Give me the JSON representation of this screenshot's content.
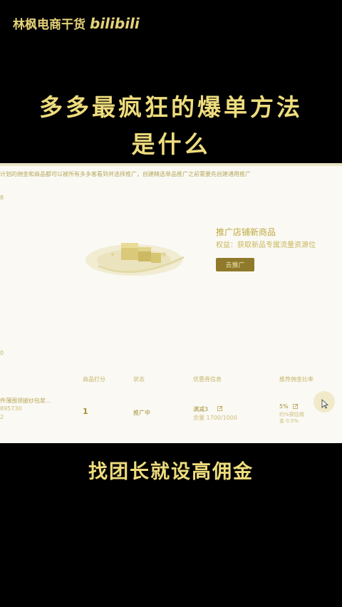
{
  "watermark": {
    "channel": "林枫电商干货",
    "brand": "bilibili"
  },
  "title": {
    "line1": "多多最疯狂的爆单方法",
    "line2": "是什么"
  },
  "screen": {
    "notice": "计划的佣金和商品都可以被所有多多客看到并选择推广，创建精选单品推广之前需要先创建通用推广",
    "side_marks": [
      "8",
      "0"
    ],
    "promo": {
      "title": "推广店铺新商品",
      "desc": "权益：获取新品专属流量资源位",
      "button": "去推广"
    },
    "table": {
      "headers": [
        "商品打分",
        "状态",
        "优惠券信息",
        "推荐佣金比率"
      ],
      "row": {
        "name": "件薄围领披纱包浆...",
        "id": "895730",
        "mark": "2",
        "score": "1",
        "status": "推广中",
        "coupon": "满减3",
        "remain": "余量 1700/1000",
        "rate": "5%",
        "rate_sub": "约%预估佣金 0.5%"
      }
    }
  },
  "subtitle": "找团长就设高佣金",
  "colors": {
    "caption": "#eedc7d",
    "background": "#000000",
    "screen": "#faf9f4",
    "accent": "#8e7a2a"
  },
  "icons": [
    "edit-icon",
    "cursor-icon"
  ]
}
